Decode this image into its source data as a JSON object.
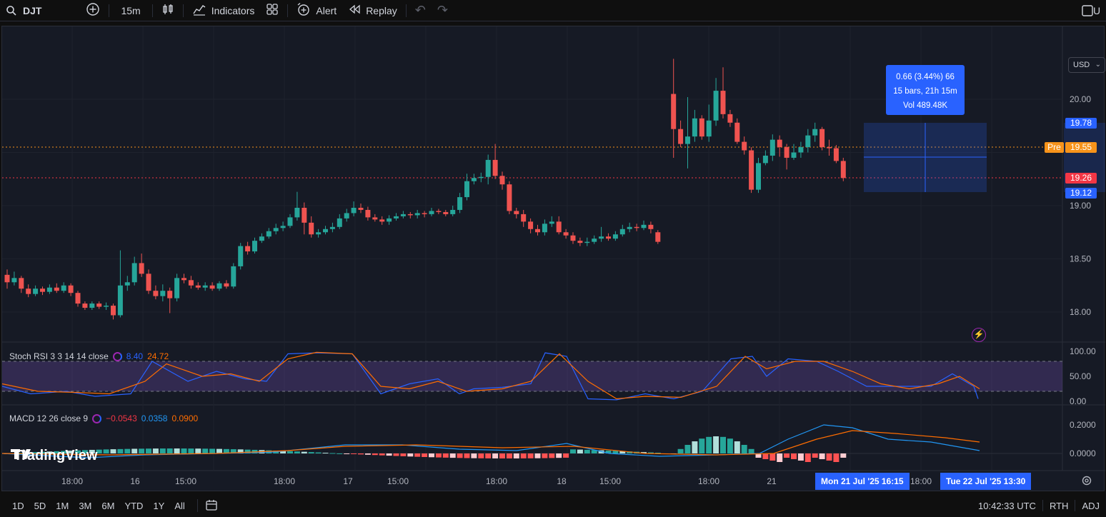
{
  "toolbar": {
    "symbol": "DJT",
    "interval": "15m",
    "indicators_label": "Indicators",
    "alert_label": "Alert",
    "replay_label": "Replay",
    "right_letter": "U"
  },
  "price_axis": {
    "currency": "USD",
    "ticks": [
      "20.00",
      "19.00",
      "18.50",
      "18.00"
    ],
    "labels": {
      "measure_high": "19.78",
      "pre_tag": "Pre",
      "pre_price": "19.55",
      "last_price": "19.26",
      "measure_low": "19.12"
    },
    "colors": {
      "blue": "#2962ff",
      "orange": "#f7931a",
      "red": "#f23645",
      "up": "#26a69a",
      "down": "#ef5350"
    }
  },
  "measure_tooltip": {
    "line1": "0.66 (3.44%) 66",
    "line2": "15 bars, 21h 15m",
    "line3": "Vol 489.48K"
  },
  "stoch_rsi": {
    "label": "Stoch RSI 3 3 14 14 close",
    "k_value": "8.40",
    "d_value": "24.72",
    "ticks": [
      "100.00",
      "50.00",
      "0.00"
    ]
  },
  "macd": {
    "label": "MACD 12 26 close 9",
    "hist_value": "−0.0543",
    "macd_value": "0.0358",
    "signal_value": "0.0900",
    "ticks": [
      "0.2000",
      "0.0000"
    ]
  },
  "time_axis": {
    "ticks": [
      "18:00",
      "16",
      "15:00",
      "18:00",
      "17",
      "15:00",
      "18:00",
      "18",
      "15:00",
      "18:00",
      "21",
      "18:00"
    ],
    "chip_start": "Mon 21 Jul '25   16:15",
    "chip_end": "Tue 22 Jul '25   13:30"
  },
  "logo_text": "TradingView",
  "bottom": {
    "ranges": [
      "1D",
      "5D",
      "1M",
      "3M",
      "6M",
      "YTD",
      "1Y",
      "All"
    ],
    "clock": "10:42:33 UTC",
    "session": "RTH",
    "adj": "ADJ"
  },
  "chart_data": {
    "type": "candlestick",
    "ylim": [
      17.8,
      20.4
    ],
    "candles": [
      [
        18.35,
        18.28,
        18.4,
        18.22
      ],
      [
        18.28,
        18.32,
        18.38,
        18.25
      ],
      [
        18.32,
        18.22,
        18.34,
        18.18
      ],
      [
        18.22,
        18.17,
        18.26,
        18.14
      ],
      [
        18.17,
        18.22,
        18.25,
        18.15
      ],
      [
        18.22,
        18.19,
        18.24,
        18.16
      ],
      [
        18.19,
        18.23,
        18.26,
        18.17
      ],
      [
        18.23,
        18.2,
        18.27,
        18.18
      ],
      [
        18.2,
        18.25,
        18.28,
        18.18
      ],
      [
        18.25,
        18.18,
        18.27,
        18.15
      ],
      [
        18.18,
        18.08,
        18.2,
        18.05
      ],
      [
        18.08,
        18.04,
        18.1,
        18.02
      ],
      [
        18.04,
        18.08,
        18.1,
        18.02
      ],
      [
        18.08,
        18.05,
        18.1,
        18.03
      ],
      [
        18.05,
        18.06,
        18.09,
        18.02
      ],
      [
        18.06,
        17.97,
        18.08,
        17.93
      ],
      [
        17.97,
        18.25,
        18.58,
        17.95
      ],
      [
        18.25,
        18.28,
        18.34,
        18.2
      ],
      [
        18.28,
        18.46,
        18.52,
        18.25
      ],
      [
        18.46,
        18.36,
        18.55,
        18.33
      ],
      [
        18.36,
        18.2,
        18.4,
        18.17
      ],
      [
        18.2,
        18.15,
        18.25,
        18.12
      ],
      [
        18.15,
        18.2,
        18.26,
        18.1
      ],
      [
        18.2,
        18.13,
        18.23,
        17.99
      ],
      [
        18.13,
        18.32,
        18.36,
        18.1
      ],
      [
        18.32,
        18.3,
        18.36,
        18.27
      ],
      [
        18.3,
        18.25,
        18.34,
        18.22
      ],
      [
        18.25,
        18.23,
        18.28,
        18.21
      ],
      [
        18.23,
        18.25,
        18.28,
        18.2
      ],
      [
        18.25,
        18.22,
        18.28,
        18.2
      ],
      [
        18.22,
        18.27,
        18.29,
        18.2
      ],
      [
        18.27,
        18.24,
        18.3,
        18.22
      ],
      [
        18.24,
        18.43,
        18.46,
        18.22
      ],
      [
        18.43,
        18.62,
        18.65,
        18.4
      ],
      [
        18.62,
        18.57,
        18.66,
        18.54
      ],
      [
        18.57,
        18.67,
        18.7,
        18.55
      ],
      [
        18.67,
        18.71,
        18.74,
        18.65
      ],
      [
        18.71,
        18.76,
        18.79,
        18.69
      ],
      [
        18.76,
        18.79,
        18.83,
        18.73
      ],
      [
        18.79,
        18.81,
        18.85,
        18.76
      ],
      [
        18.81,
        18.89,
        18.92,
        18.79
      ],
      [
        18.89,
        18.98,
        19.13,
        18.86
      ],
      [
        18.98,
        18.84,
        19.03,
        18.73
      ],
      [
        18.84,
        18.73,
        18.9,
        18.7
      ],
      [
        18.73,
        18.75,
        18.78,
        18.7
      ],
      [
        18.75,
        18.78,
        18.81,
        18.73
      ],
      [
        18.78,
        18.8,
        18.84,
        18.75
      ],
      [
        18.8,
        18.88,
        18.92,
        18.78
      ],
      [
        18.88,
        18.93,
        18.97,
        18.85
      ],
      [
        18.93,
        18.98,
        19.04,
        18.9
      ],
      [
        18.98,
        18.96,
        19.02,
        18.93
      ],
      [
        18.96,
        18.89,
        18.99,
        18.86
      ],
      [
        18.89,
        18.87,
        18.92,
        18.85
      ],
      [
        18.87,
        18.85,
        18.9,
        18.82
      ],
      [
        18.85,
        18.88,
        18.91,
        18.82
      ],
      [
        18.88,
        18.9,
        18.93,
        18.86
      ],
      [
        18.9,
        18.92,
        18.95,
        18.88
      ],
      [
        18.92,
        18.91,
        18.94,
        18.88
      ],
      [
        18.91,
        18.93,
        18.96,
        18.88
      ],
      [
        18.93,
        18.92,
        18.95,
        18.89
      ],
      [
        18.92,
        18.95,
        18.98,
        18.9
      ],
      [
        18.95,
        18.94,
        18.97,
        18.92
      ],
      [
        18.94,
        18.92,
        18.96,
        18.9
      ],
      [
        18.92,
        18.96,
        19.0,
        18.9
      ],
      [
        18.96,
        19.08,
        19.12,
        18.93
      ],
      [
        19.08,
        19.23,
        19.3,
        19.05
      ],
      [
        19.23,
        19.26,
        19.3,
        19.2
      ],
      [
        19.26,
        19.27,
        19.31,
        19.22
      ],
      [
        19.27,
        19.43,
        19.48,
        19.2
      ],
      [
        19.43,
        19.28,
        19.58,
        19.25
      ],
      [
        19.28,
        19.2,
        19.32,
        19.15
      ],
      [
        19.2,
        18.95,
        19.23,
        18.92
      ],
      [
        18.95,
        18.92,
        18.98,
        18.88
      ],
      [
        18.92,
        18.85,
        18.96,
        18.8
      ],
      [
        18.85,
        18.78,
        18.88,
        18.74
      ],
      [
        18.78,
        18.75,
        18.82,
        18.72
      ],
      [
        18.75,
        18.83,
        18.87,
        18.72
      ],
      [
        18.83,
        18.85,
        18.9,
        18.8
      ],
      [
        18.85,
        18.75,
        18.9,
        18.73
      ],
      [
        18.75,
        18.72,
        18.78,
        18.69
      ],
      [
        18.72,
        18.67,
        18.75,
        18.64
      ],
      [
        18.67,
        18.65,
        18.7,
        18.62
      ],
      [
        18.65,
        18.66,
        18.7,
        18.62
      ],
      [
        18.66,
        18.69,
        18.72,
        18.64
      ],
      [
        18.69,
        18.71,
        18.8,
        18.66
      ],
      [
        18.71,
        18.69,
        18.74,
        18.67
      ],
      [
        18.69,
        18.73,
        18.76,
        18.67
      ],
      [
        18.73,
        18.78,
        18.82,
        18.71
      ],
      [
        18.78,
        18.8,
        18.84,
        18.75
      ],
      [
        18.8,
        18.79,
        18.83,
        18.76
      ],
      [
        18.79,
        18.82,
        18.86,
        18.77
      ],
      [
        18.82,
        18.78,
        18.85,
        18.74
      ],
      [
        18.75,
        18.66,
        18.77,
        18.64
      ],
      [
        20.05,
        19.72,
        20.38,
        19.45
      ],
      [
        19.72,
        19.58,
        19.8,
        19.55
      ],
      [
        19.58,
        19.65,
        20.02,
        19.35
      ],
      [
        19.65,
        19.82,
        19.9,
        19.6
      ],
      [
        19.82,
        19.65,
        19.85,
        19.62
      ],
      [
        19.65,
        19.8,
        19.95,
        19.6
      ],
      [
        19.8,
        20.08,
        20.2,
        19.75
      ],
      [
        20.08,
        19.86,
        20.3,
        19.82
      ],
      [
        19.86,
        19.78,
        19.9,
        19.74
      ],
      [
        19.78,
        19.6,
        19.82,
        19.58
      ],
      [
        19.6,
        19.52,
        19.65,
        19.48
      ],
      [
        19.52,
        19.15,
        19.55,
        19.12
      ],
      [
        19.15,
        19.4,
        19.45,
        19.12
      ],
      [
        19.4,
        19.47,
        19.52,
        19.38
      ],
      [
        19.47,
        19.62,
        19.67,
        19.42
      ],
      [
        19.62,
        19.55,
        19.66,
        19.46
      ],
      [
        19.55,
        19.45,
        19.58,
        19.34
      ],
      [
        19.45,
        19.5,
        19.58,
        19.43
      ],
      [
        19.5,
        19.55,
        19.6,
        19.45
      ],
      [
        19.55,
        19.66,
        19.72,
        19.5
      ],
      [
        19.66,
        19.72,
        19.78,
        19.6
      ],
      [
        19.72,
        19.55,
        19.74,
        19.52
      ],
      [
        19.55,
        19.54,
        19.62,
        19.47
      ],
      [
        19.54,
        19.42,
        19.57,
        19.4
      ],
      [
        19.42,
        19.26,
        19.45,
        19.23
      ]
    ]
  }
}
